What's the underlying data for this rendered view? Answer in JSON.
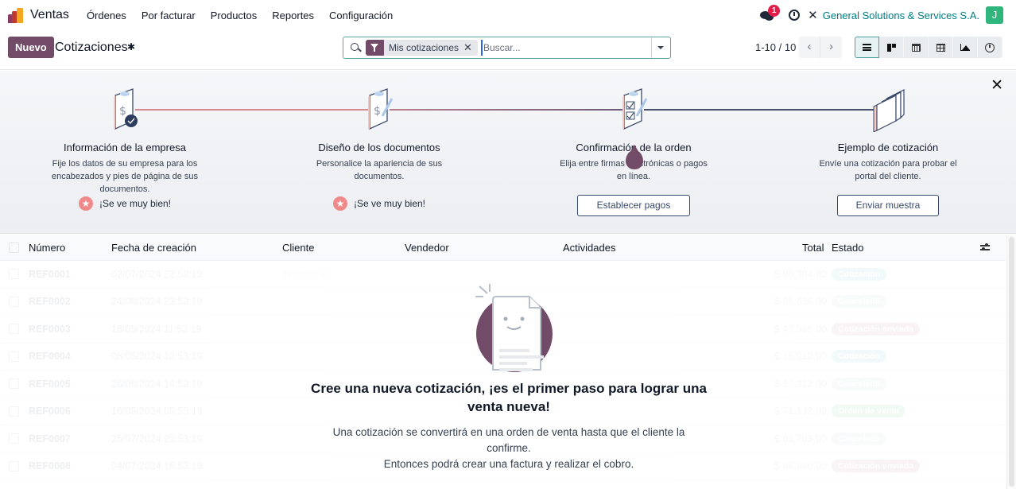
{
  "app": {
    "name": "Ventas",
    "menu": [
      "Órdenes",
      "Por facturar",
      "Productos",
      "Reportes",
      "Configuración"
    ],
    "messages_badge": "1",
    "company": "General Solutions & Services S.A.",
    "avatar_initial": "J",
    "icons": {
      "logo": "odoo-sales-logo-icon",
      "chat": "chat-icon",
      "activity": "clock-icon",
      "debug": "tools-icon"
    }
  },
  "control_panel": {
    "new_label": "Nuevo",
    "title": "Cotizaciones",
    "search": {
      "facet_label": "Mis cotizaciones",
      "placeholder": "Buscar...",
      "value": ""
    },
    "pager": "1-10 / 10",
    "views": [
      "list",
      "kanban",
      "calendar",
      "pivot",
      "graph",
      "activity"
    ],
    "active_view": "list"
  },
  "onboarding": {
    "steps": [
      {
        "title": "Información de la empresa",
        "description": "Fije los datos de su empresa para los encabezados y pies de página de sus documentos.",
        "done": true,
        "done_label": "¡Se ve muy bien!"
      },
      {
        "title": "Diseño de los documentos",
        "description": "Personalice la apariencia de sus documentos.",
        "done": true,
        "done_label": "¡Se ve muy bien!"
      },
      {
        "title": "Confirmación de la orden",
        "description": "Elija entre firmas electrónicas o pagos en línea.",
        "done": false,
        "button_label": "Establecer pagos"
      },
      {
        "title": "Ejemplo de cotización",
        "description": "Envíe una cotización para probar el portal del cliente.",
        "done": false,
        "button_label": "Enviar muestra"
      }
    ],
    "colors": {
      "line_done": "#d48a93",
      "line_todo": "#4b4f6e",
      "accent": "#714b67"
    }
  },
  "list": {
    "columns": [
      "Número",
      "Fecha de creación",
      "Cliente",
      "Vendedor",
      "Actividades",
      "Total",
      "Estado"
    ],
    "rows": [
      {
        "number": "REF0001",
        "date": "02/07/2024 22:53:19",
        "client": "Thomas P...",
        "total": "$ 90,304.00",
        "state": "Cotización",
        "state_color": "#d8eef1"
      },
      {
        "number": "REF0002",
        "date": "24/06/2024 23:53:19",
        "client": "",
        "total": "$ 95,636.00",
        "state": "Cancelado",
        "state_color": "#eef0f2"
      },
      {
        "number": "REF0003",
        "date": "18/05/2024 11:53:19",
        "client": "",
        "total": "$ 47,965.00",
        "state": "Cotización enviada",
        "state_color": "#ecdde3"
      },
      {
        "number": "REF0004",
        "date": "08/05/2024 12:53:19",
        "client": "",
        "total": "$ 15,010.00",
        "state": "Cotización",
        "state_color": "#d8eef1"
      },
      {
        "number": "REF0005",
        "date": "26/05/2024 14:53:19",
        "client": "",
        "total": "$ 87,312.00",
        "state": "Cancelado",
        "state_color": "#eef0f2"
      },
      {
        "number": "REF0006",
        "date": "16/05/2024 05:53:19",
        "client": "",
        "total": "$ 71,132.00",
        "state": "Orden de venta",
        "state_color": "#d6efdf"
      },
      {
        "number": "REF0007",
        "date": "25/07/2024 20:53:19",
        "client": "",
        "total": "$ 61,703.00",
        "state": "Cancelado",
        "state_color": "#eef0f2"
      },
      {
        "number": "REF0008",
        "date": "04/07/2024 16:53:19",
        "client": "",
        "total": "$ 96,990.00",
        "state": "Cotización enviada",
        "state_color": "#ecdde3"
      }
    ]
  },
  "empty_state": {
    "title": "Cree una nueva cotización, ¡es el primer paso para lograr una venta nueva!",
    "line1": "Una cotización se convertirá en una orden de venta hasta que el cliente la confirme.",
    "line2": "Entonces podrá crear una factura y realizar el cobro."
  }
}
